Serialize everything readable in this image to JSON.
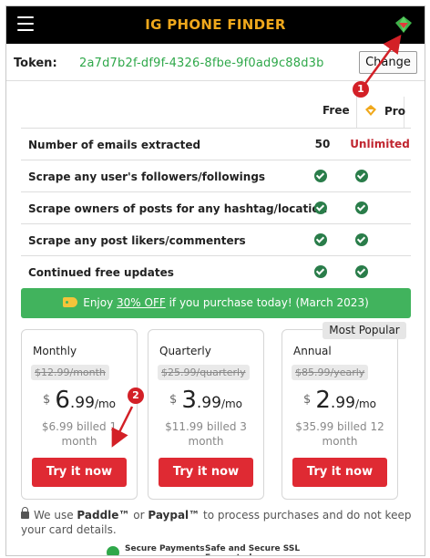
{
  "header": {
    "title": "IG PHONE FINDER",
    "menu_icon": "hamburger-menu-icon",
    "gem_icon": "pro-gem-icon"
  },
  "token": {
    "label": "Token:",
    "value": "2a7d7b2f-df9f-4326-8fbe-9f0ad9c88d3b",
    "change_label": "Change"
  },
  "features": {
    "col_free": "Free",
    "col_pro": "Pro",
    "rows": [
      {
        "label": "Number of emails extracted",
        "free": "50",
        "pro": "Unlimited"
      },
      {
        "label": "Scrape any user's followers/followings",
        "free": "check",
        "pro": "check"
      },
      {
        "label": "Scrape owners of posts for any hashtag/location",
        "free": "check",
        "pro": "check"
      },
      {
        "label": "Scrape any post likers/commenters",
        "free": "check",
        "pro": "check"
      },
      {
        "label": "Continued free updates",
        "free": "check",
        "pro": "check"
      }
    ]
  },
  "promo": {
    "before": "Enjoy ",
    "discount": "30% OFF",
    "after": " if you purchase today!  (March 2023)"
  },
  "plans": [
    {
      "name": "Monthly",
      "old_price": "$12.99/month",
      "currency": "$",
      "dollars": "6",
      "cents": ".99",
      "per": "/mo",
      "billed": "$6.99 billed 1 month",
      "button": "Try it now"
    },
    {
      "name": "Quarterly",
      "old_price": "$25.99/quarterly",
      "currency": "$",
      "dollars": "3",
      "cents": ".99",
      "per": "/mo",
      "billed": "$11.99 billed 3 month",
      "button": "Try it now"
    },
    {
      "name": "Annual",
      "old_price": "$85.99/yearly",
      "currency": "$",
      "dollars": "2",
      "cents": ".99",
      "per": "/mo",
      "billed": "$35.99 billed 12 month",
      "button": "Try it now"
    }
  ],
  "popular_badge": "Most Popular",
  "footer": {
    "prefix": "We use ",
    "paddle": "Paddle™",
    "or": " or ",
    "paypal": "Paypal™",
    "suffix": " to process purchases and do not keep your card details.",
    "secure_payments": "Secure Payments",
    "secure_ssl": "Safe and Secure SSL Encrypted"
  },
  "annotations": [
    "1",
    "2"
  ],
  "colors": {
    "header_bg": "#000000",
    "title": "#f0a81c",
    "token": "#2fa84a",
    "unlimited": "#c0252f",
    "check": "#2a7d4a",
    "promo_bg": "#41b35d",
    "button": "#df2a33",
    "annotation": "#d32027"
  }
}
